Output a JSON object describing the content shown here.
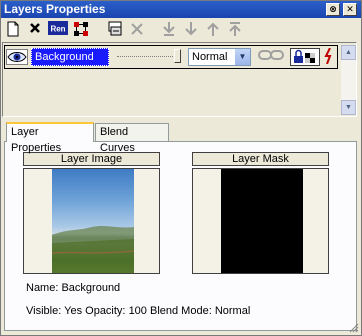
{
  "window": {
    "title": "Layers Properties",
    "pin_button": "⊗",
    "close_button": "✕"
  },
  "toolbar": {
    "buttons": [
      {
        "name": "new-layer-icon",
        "glyph": "🗋",
        "enabled": true
      },
      {
        "name": "delete-layer-icon",
        "glyph": "✖",
        "enabled": true
      },
      {
        "name": "rename-layer-icon",
        "glyph": "Ren",
        "enabled": true
      },
      {
        "name": "arrange-icon",
        "glyph": "▦",
        "enabled": true
      },
      {
        "name": "merge-icon",
        "glyph": "▣",
        "enabled": true
      },
      {
        "name": "delete-disabled-icon",
        "glyph": "✂",
        "enabled": false
      },
      {
        "name": "move-bottom-icon",
        "glyph": "⤓",
        "enabled": false
      },
      {
        "name": "move-down-icon",
        "glyph": "↓",
        "enabled": false
      },
      {
        "name": "move-up-icon",
        "glyph": "↑",
        "enabled": false
      },
      {
        "name": "move-top-icon",
        "glyph": "⤒",
        "enabled": false
      }
    ]
  },
  "layer_list": {
    "layers": [
      {
        "name": "Background",
        "visible": true,
        "opacity": 100,
        "blend_mode": "Normal"
      }
    ]
  },
  "tabs": [
    {
      "label": "Layer Properties",
      "active": true
    },
    {
      "label": "Blend Curves",
      "active": false
    }
  ],
  "previews": {
    "layer_image_label": "Layer Image",
    "layer_mask_label": "Layer Mask"
  },
  "info": {
    "name_label": "Name:",
    "name_value": "Background",
    "visible_label": "Visible:",
    "visible_value": "Yes",
    "opacity_label": "Opacity:",
    "opacity_value": "100",
    "blend_label": "Blend Mode:",
    "blend_value": "Normal"
  },
  "colors": {
    "titlebar": "#1b45b0",
    "selected_layer": "#1a1aff",
    "panel": "#ece9d8"
  }
}
